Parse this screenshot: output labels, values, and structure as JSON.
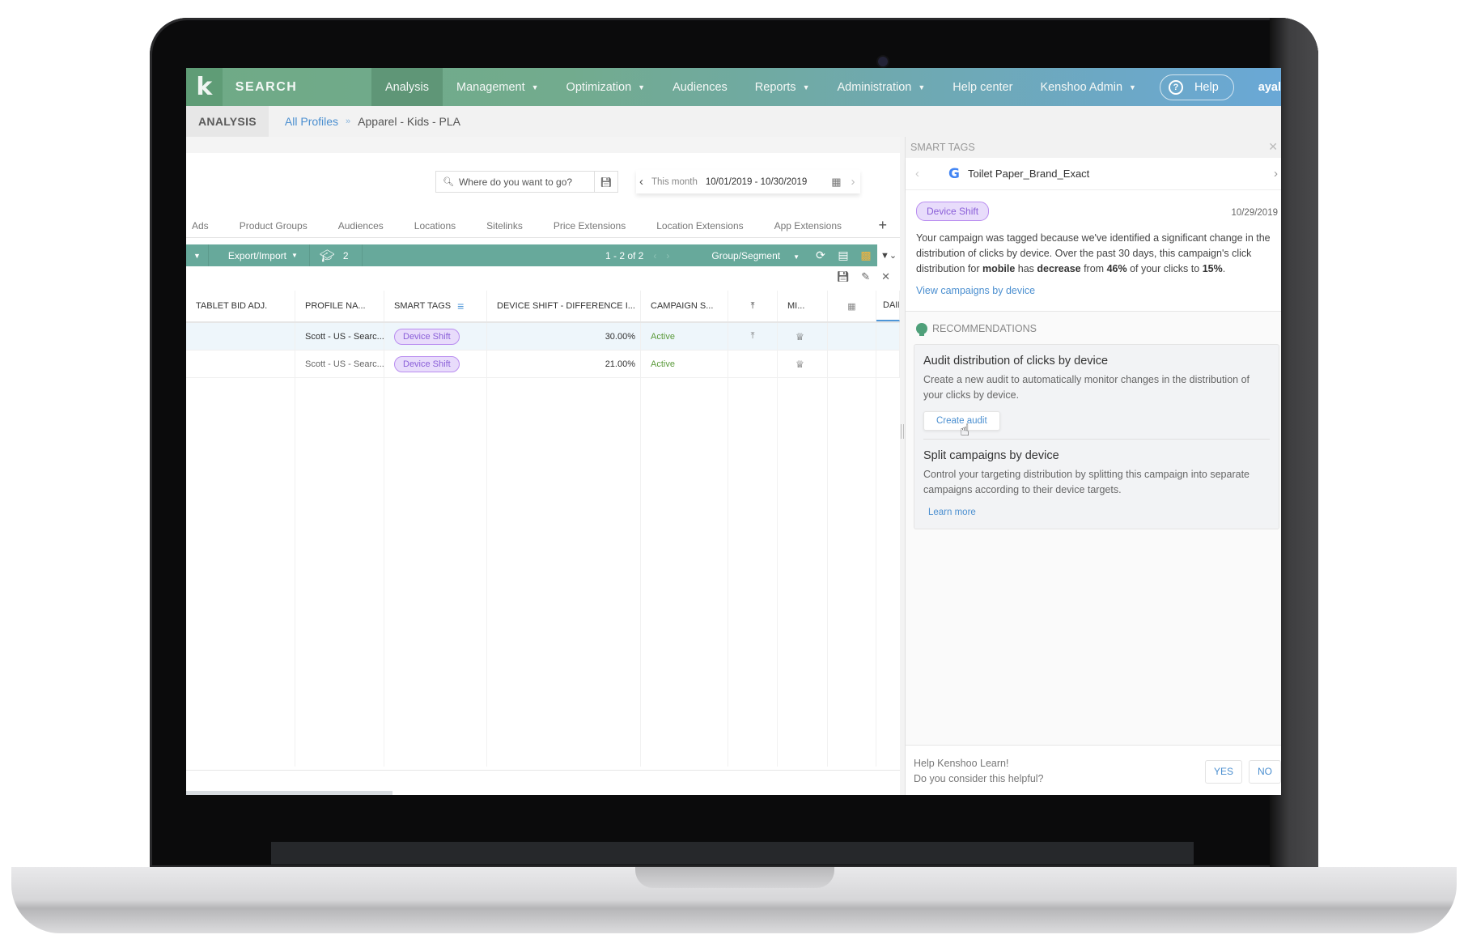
{
  "app": {
    "logo": "k",
    "product": "SEARCH",
    "nav": [
      {
        "label": "Analysis",
        "active": true,
        "dropdown": false
      },
      {
        "label": "Management",
        "dropdown": true
      },
      {
        "label": "Optimization",
        "dropdown": true
      },
      {
        "label": "Audiences",
        "dropdown": false
      },
      {
        "label": "Reports",
        "dropdown": true
      },
      {
        "label": "Administration",
        "dropdown": true
      },
      {
        "label": "Help center",
        "dropdown": false
      },
      {
        "label": "Kenshoo Admin",
        "dropdown": true
      }
    ],
    "help_label": "Help",
    "user": "ayal"
  },
  "breadcrumb": {
    "section": "ANALYSIS",
    "link": "All Profiles",
    "separator": "»",
    "current": "Apparel - Kids - PLA"
  },
  "search": {
    "placeholder": "Where do you want to go?"
  },
  "date": {
    "preset": "This month",
    "range": "10/01/2019 - 10/30/2019"
  },
  "tabs": [
    "Ads",
    "Product Groups",
    "Audiences",
    "Locations",
    "Sitelinks",
    "Price Extensions",
    "Location Extensions",
    "App Extensions"
  ],
  "toolbar": {
    "export_label": "Export/Import",
    "learn_count": "2",
    "pager": "1 - 2  of  2",
    "group_label": "Group/Segment"
  },
  "table": {
    "columns": [
      "TABLET BID ADJ.",
      "PROFILE NA...",
      "SMART TAGS",
      "DEVICE SHIFT - DIFFERENCE I...",
      "CAMPAIGN S...",
      "",
      "MI...",
      "",
      "DAIL"
    ],
    "rows": [
      {
        "tablet_bid": "",
        "profile": "Scott - US - Searc...",
        "tag": "Device Shift",
        "device_shift": "30.00%",
        "status": "Active",
        "selected": true
      },
      {
        "tablet_bid": "",
        "profile": "Scott - US - Searc...",
        "tag": "Device Shift",
        "device_shift": "21.00%",
        "status": "Active",
        "selected": false
      }
    ]
  },
  "panel": {
    "title": "SMART TAGS",
    "campaign": "Toilet Paper_Brand_Exact",
    "tag": "Device Shift",
    "tag_date": "10/29/2019",
    "desc_parts": {
      "p1": "Your campaign was tagged because we've identified a significant change in the distribution of clicks by device. Over the past 30 days, this campaign's click distribution for ",
      "b1": "mobile",
      "p2": " has ",
      "b2": "decrease",
      "p3": " from ",
      "b3": "46%",
      "p4": " of your clicks to ",
      "b4": "15%",
      "p5": "."
    },
    "view_link": "View campaigns by device",
    "recommendations_title": "RECOMMENDATIONS",
    "recommendations": [
      {
        "title": "Audit distribution of clicks by device",
        "text": "Create a new audit to automatically monitor changes in the distribution of your clicks by device.",
        "action": "Create audit"
      },
      {
        "title": "Split campaigns by device",
        "text": "Control your targeting distribution by splitting this campaign into separate campaigns according to their device targets.",
        "action": "Learn more"
      }
    ],
    "feedback": {
      "line1": "Help Kenshoo Learn!",
      "line2": "Do you consider this helpful?",
      "yes": "YES",
      "no": "NO"
    }
  },
  "colors": {
    "header_green": "#6faa86",
    "header_blue": "#6aa8d6",
    "toolbar_teal": "#67a99b",
    "tag_purple": "#8a5fd8",
    "link_blue": "#4b8fd0",
    "active_green": "#5a9a3a"
  }
}
